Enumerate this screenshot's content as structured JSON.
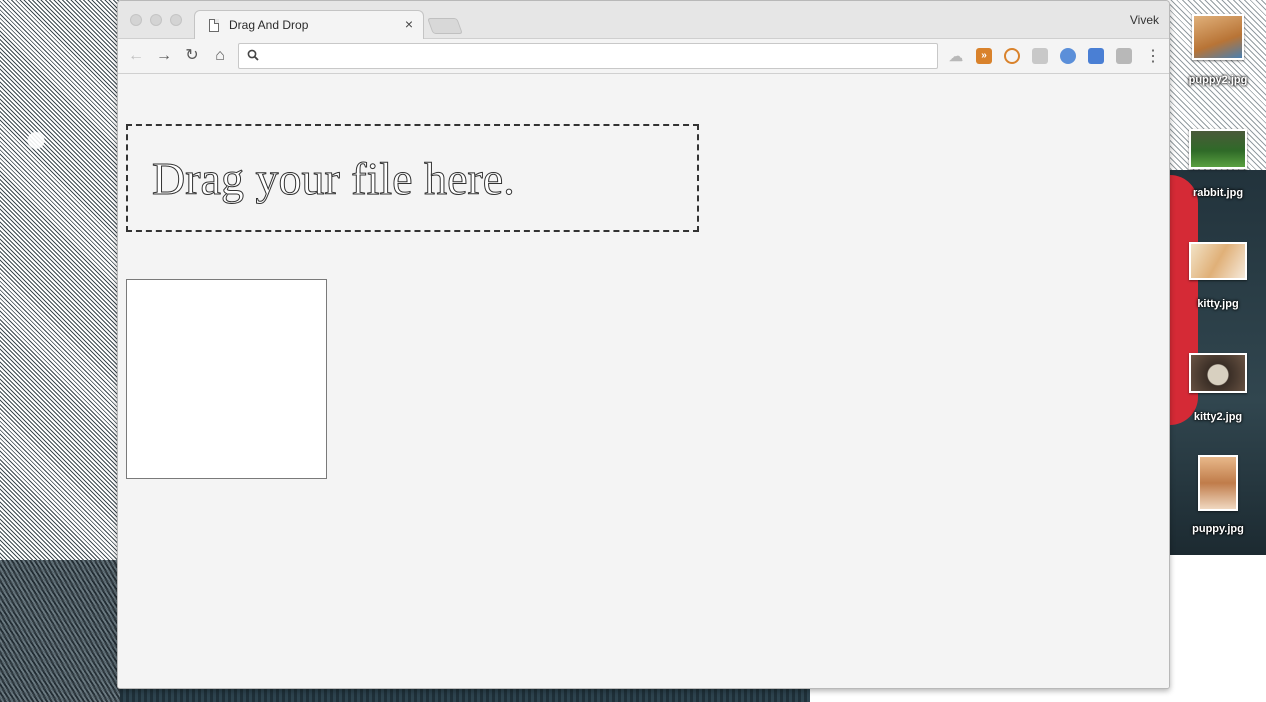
{
  "browser": {
    "tab_title": "Drag And Drop",
    "tab_close": "×",
    "profile_name": "Vivek",
    "omnibox_value": ""
  },
  "page": {
    "dropzone_text": "Drag your file here."
  },
  "desktop": {
    "files": [
      {
        "name": "puppy2.jpg",
        "thumb_color": "#c98a4a"
      },
      {
        "name": "rabbit.jpg",
        "thumb_color": "#3e7a2c"
      },
      {
        "name": "kitty.jpg",
        "thumb_color": "#e8c9a0"
      },
      {
        "name": "kitty2.jpg",
        "thumb_color": "#5a4a3a"
      },
      {
        "name": "puppy.jpg",
        "thumb_color": "#d49a6a"
      }
    ]
  },
  "colors": {
    "window_bg": "#f4f4f4",
    "dashed_border": "#333333",
    "accent_orange": "#d9822b",
    "accent_blue": "#4a7fd4"
  }
}
